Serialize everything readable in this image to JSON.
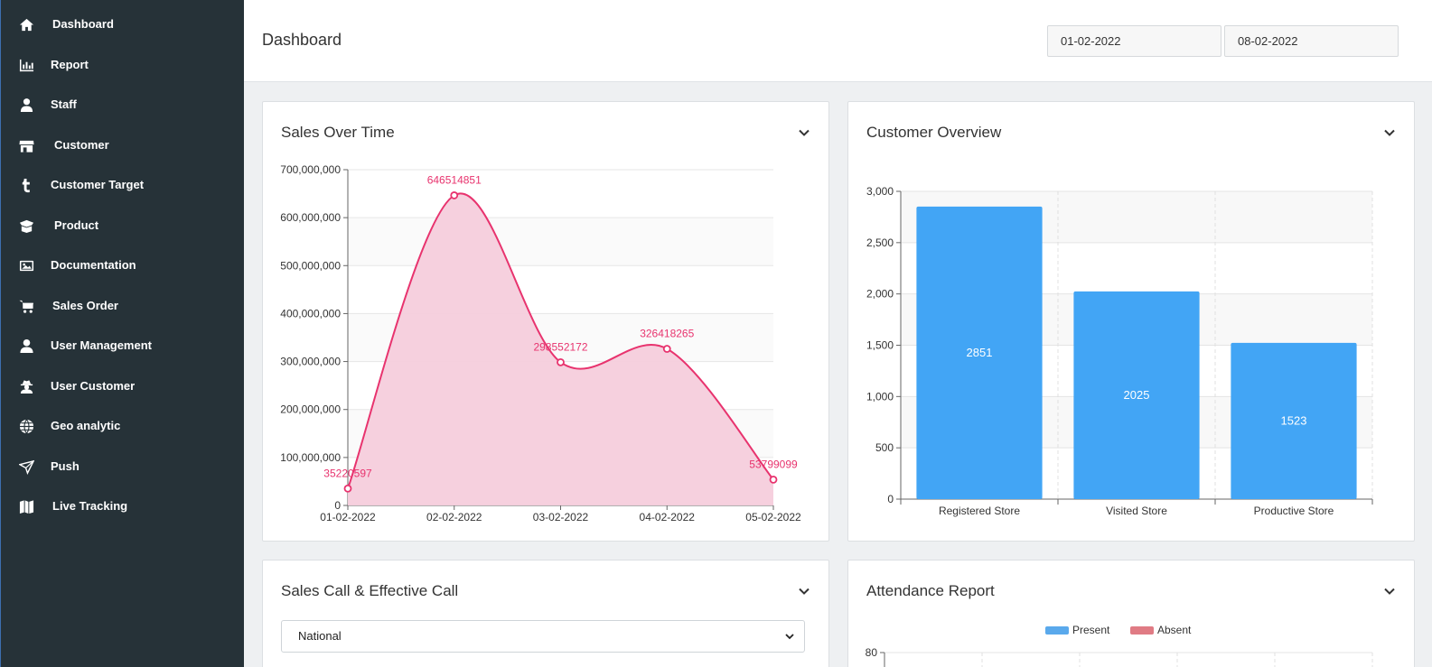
{
  "sidebar": {
    "items": [
      {
        "label": "Dashboard",
        "icon": "home-icon"
      },
      {
        "label": "Report",
        "icon": "bar-chart-icon"
      },
      {
        "label": "Staff",
        "icon": "staff-icon"
      },
      {
        "label": "Customer",
        "icon": "store-icon"
      },
      {
        "label": "Customer Target",
        "icon": "tumblr-icon"
      },
      {
        "label": "Product",
        "icon": "box-open-icon"
      },
      {
        "label": "Documentation",
        "icon": "image-icon"
      },
      {
        "label": "Sales Order",
        "icon": "cart-icon"
      },
      {
        "label": "User Management",
        "icon": "user-icon"
      },
      {
        "label": "User Customer",
        "icon": "user-secret-icon"
      },
      {
        "label": "Geo analytic",
        "icon": "globe-icon"
      },
      {
        "label": "Push",
        "icon": "paper-plane-icon"
      },
      {
        "label": "Live Tracking",
        "icon": "map-icon"
      }
    ]
  },
  "header": {
    "title": "Dashboard",
    "date_from": "01-02-2022",
    "date_to": "08-02-2022"
  },
  "cards": {
    "sales_over_time": {
      "title": "Sales Over Time"
    },
    "customer_overview": {
      "title": "Customer Overview"
    },
    "sales_call": {
      "title": "Sales Call & Effective Call",
      "select_value": "National"
    },
    "attendance": {
      "title": "Attendance Report"
    }
  },
  "colors": {
    "sidebar_bg": "#263238",
    "line_series": "#e8336e",
    "line_fill": "#f6cddc",
    "bar_series": "#42a5f5",
    "present": "#5aa9ec",
    "absent": "#e07b84"
  },
  "chart_data": [
    {
      "type": "area",
      "x": [
        "01-02-2022",
        "02-02-2022",
        "03-02-2022",
        "04-02-2022",
        "05-02-2022"
      ],
      "values": [
        35220597,
        646514851,
        298552172,
        326418265,
        53799099
      ],
      "data_labels": [
        "35220597",
        "646514851",
        "298552172",
        "326418265",
        "53799099"
      ],
      "ylim": [
        0,
        700000000
      ],
      "yticks": [
        "0",
        "100,000,000",
        "200,000,000",
        "300,000,000",
        "400,000,000",
        "500,000,000",
        "600,000,000",
        "700,000,000"
      ],
      "grid": true
    },
    {
      "type": "bar",
      "categories": [
        "Registered Store",
        "Visited Store",
        "Productive Store"
      ],
      "values": [
        2851,
        2025,
        1523
      ],
      "data_labels": [
        "2851",
        "2025",
        "1523"
      ],
      "ylim": [
        0,
        3000
      ],
      "yticks": [
        "0",
        "500",
        "1,000",
        "1,500",
        "2,000",
        "2,500",
        "3,000"
      ],
      "grid": true
    },
    {
      "type": "bar",
      "series": [
        {
          "name": "Present"
        },
        {
          "name": "Absent"
        }
      ],
      "legend": "top",
      "yticks": [
        "80"
      ]
    }
  ]
}
